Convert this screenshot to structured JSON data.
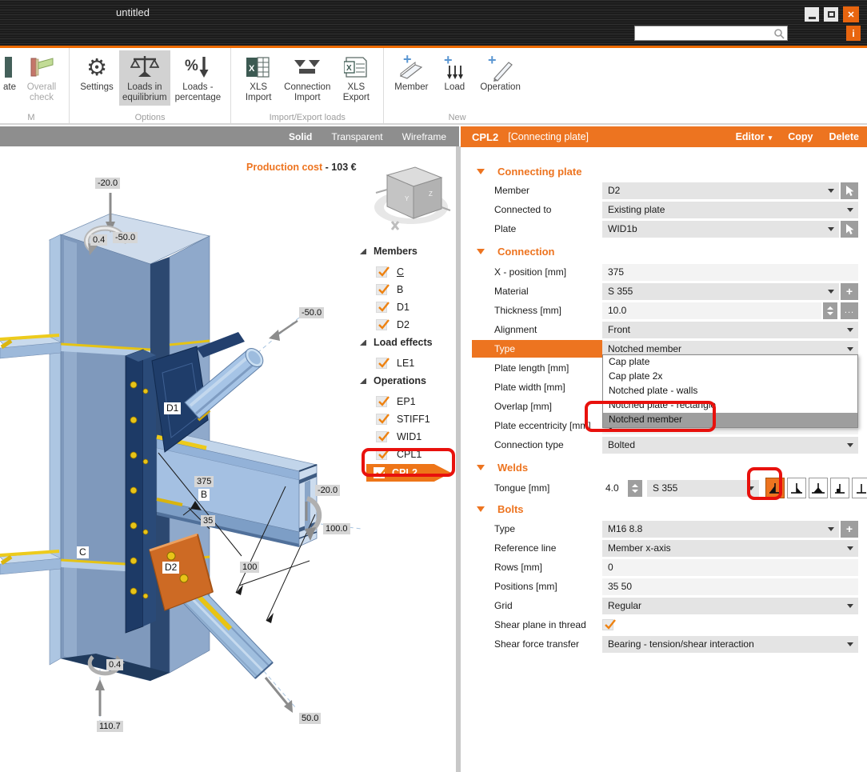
{
  "titlebar": {
    "title": "untitled",
    "search_value": "",
    "info_label": "i"
  },
  "ribbon": {
    "partial_group": {
      "partial_button": "ate",
      "overall_check": "Overall\ncheck",
      "group_label": "M"
    },
    "options": {
      "label": "Options",
      "settings": "Settings",
      "loads_in_equilibrium": "Loads in\nequilibrium",
      "loads_percentage": "Loads -\npercentage"
    },
    "import_export": {
      "label": "Import/Export loads",
      "xls_import": "XLS\nImport",
      "connection_import": "Connection\nImport",
      "xls_export": "XLS\nExport"
    },
    "new_group": {
      "label": "New",
      "member": "Member",
      "load": "Load",
      "operation": "Operation"
    }
  },
  "viewport": {
    "tabs": {
      "solid": "Solid",
      "transparent": "Transparent",
      "wireframe": "Wireframe"
    },
    "production_cost": {
      "label": "Production cost",
      "separator": "-",
      "value": "103 €"
    },
    "tree": {
      "members": {
        "label": "Members",
        "items": [
          "C",
          "B",
          "D1",
          "D2"
        ]
      },
      "load_effects": {
        "label": "Load effects",
        "items": [
          "LE1"
        ]
      },
      "operations": {
        "label": "Operations",
        "items": [
          "EP1",
          "STIFF1",
          "WID1",
          "CPL1"
        ],
        "selected": "CPL2"
      }
    },
    "scene_labels": {
      "load_top": "-20.0",
      "moment_top": "0.4",
      "load_top2": "-50.0",
      "load_left": "-50.0",
      "dim_375": "375",
      "dim_35": "35",
      "dim_100": "100",
      "load_right": "-20.0",
      "load_right2": "100.0",
      "moment_bottom": "0.4",
      "load_bottom": "110.7",
      "load_diag": "50.0",
      "member_c": "C",
      "member_b": "B",
      "member_d1": "D1",
      "member_d2": "D2"
    }
  },
  "panel": {
    "header": {
      "id": "CPL2",
      "subtitle": "[Connecting plate]",
      "editor": "Editor",
      "copy": "Copy",
      "delete": "Delete"
    },
    "connecting_plate": {
      "title": "Connecting plate",
      "member_label": "Member",
      "member_value": "D2",
      "connected_to_label": "Connected to",
      "connected_to_value": "Existing plate",
      "plate_label": "Plate",
      "plate_value": "WID1b"
    },
    "connection": {
      "title": "Connection",
      "x_position_label": "X - position [mm]",
      "x_position_value": "375",
      "material_label": "Material",
      "material_value": "S 355",
      "thickness_label": "Thickness [mm]",
      "thickness_value": "10.0",
      "alignment_label": "Alignment",
      "alignment_value": "Front",
      "type_label": "Type",
      "type_value": "Notched member",
      "type_options": [
        "Cap plate",
        "Cap plate 2x",
        "Notched plate - walls",
        "Notched plate - rectangle",
        "Notched member"
      ],
      "plate_length_label": "Plate length [mm]",
      "plate_width_label": "Plate width [mm]",
      "overlap_label": "Overlap [mm]",
      "plate_eccentricity_label": "Plate eccentricity [mm]",
      "plate_eccentricity_value": "0",
      "connection_type_label": "Connection type",
      "connection_type_value": "Bolted"
    },
    "welds": {
      "title": "Welds",
      "tongue_label": "Tongue [mm]",
      "tongue_value": "4.0",
      "material_value": "S 355"
    },
    "bolts": {
      "title": "Bolts",
      "type_label": "Type",
      "type_value": "M16 8.8",
      "reference_line_label": "Reference line",
      "reference_line_value": "Member x-axis",
      "rows_label": "Rows [mm]",
      "rows_value": "0",
      "positions_label": "Positions [mm]",
      "positions_value": "35 50",
      "grid_label": "Grid",
      "grid_value": "Regular",
      "shear_plane_label": "Shear plane in thread",
      "shear_force_label": "Shear force transfer",
      "shear_force_value": "Bearing - tension/shear interaction"
    }
  },
  "colors": {
    "accent": "#ED7420",
    "annotation": "#E8110D",
    "field_gray": "#E4E4E4",
    "selected_option": "#9E9E9E"
  }
}
